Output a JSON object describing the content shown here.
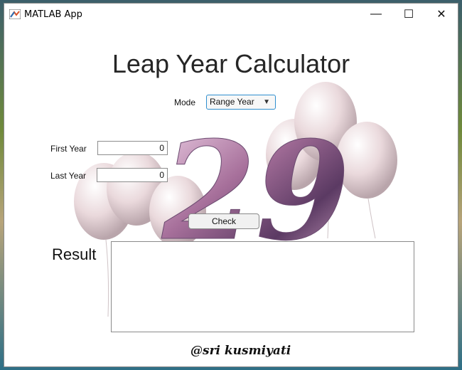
{
  "window": {
    "title": "MATLAB App",
    "minimize_glyph": "—",
    "maximize_glyph": "☐",
    "close_glyph": "✕"
  },
  "app": {
    "heading": "Leap Year Calculator",
    "mode": {
      "label": "Mode",
      "selected": "Range Year",
      "caret": "▼"
    },
    "first_year": {
      "label": "First Year",
      "value": "0"
    },
    "last_year": {
      "label": "Last Year",
      "value": "0"
    },
    "check_button": "Check",
    "result_label": "Result",
    "result_value": "",
    "signature": "@sri kusmiyati"
  },
  "background_art": {
    "number_text": "29",
    "balloon_color": "#e8dede",
    "number_color": "#b07aa6"
  },
  "colors": {
    "select_border": "#2f8fcf",
    "window_bg": "#ffffff"
  }
}
